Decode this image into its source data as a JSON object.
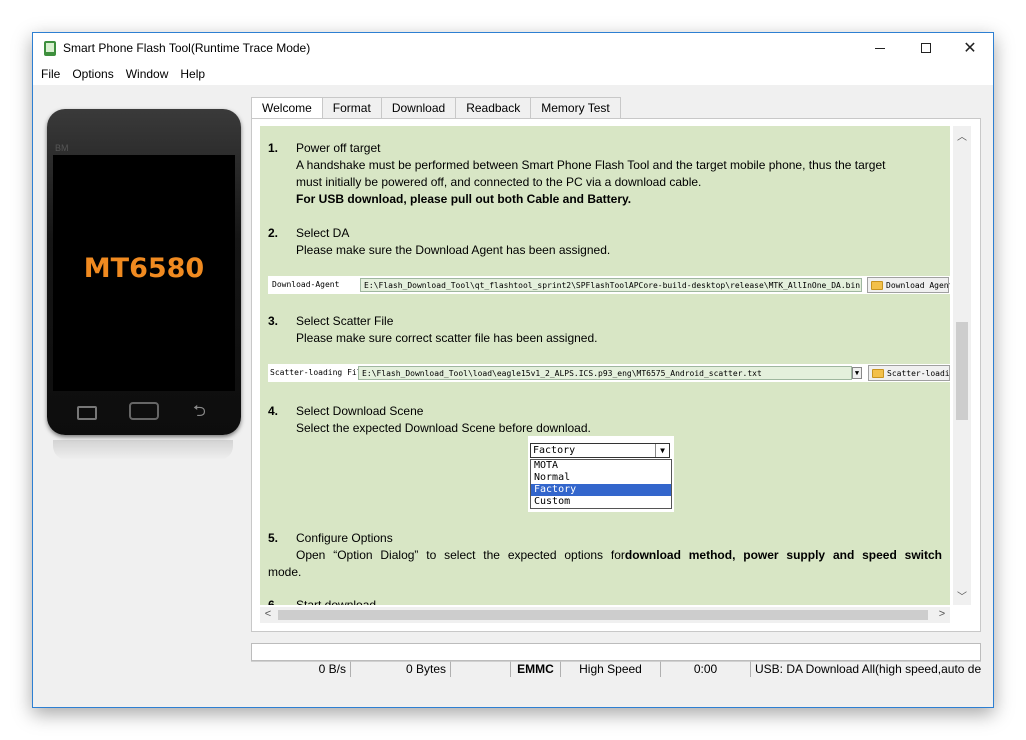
{
  "window": {
    "title": "Smart Phone Flash Tool(Runtime Trace Mode)",
    "min_icon": "minimize-icon",
    "max_icon": "maximize-icon",
    "close_icon": "close-icon"
  },
  "menu": [
    "File",
    "Options",
    "Window",
    "Help"
  ],
  "phone": {
    "brand": "BM",
    "model": "MT6580",
    "model_color": "#f08a20"
  },
  "tabs": [
    "Welcome",
    "Format",
    "Download",
    "Readback",
    "Memory Test"
  ],
  "active_tab": "Welcome",
  "steps": {
    "s1": {
      "num": "1.",
      "title": "Power off target",
      "line1": "A handshake must be performed between Smart Phone Flash Tool and the target mobile phone, thus the target",
      "line2": "must initially be powered off, and connected to the PC via a download cable.",
      "line3": "For USB download, please pull out both Cable and Battery."
    },
    "s2": {
      "num": "2.",
      "title": "Select DA",
      "line1": "Please make sure the Download Agent has been assigned."
    },
    "download_agent": {
      "label": "Download-Agent",
      "path": "E:\\Flash_Download_Tool\\qt_flashtool_sprint2\\SPFlashToolAPCore-build-desktop\\release\\MTK_AllInOne_DA.bin",
      "button": "Download Agent"
    },
    "s3": {
      "num": "3.",
      "title": "Select Scatter File",
      "line1": "Please make sure correct scatter file has been assigned."
    },
    "scatter": {
      "label": "Scatter-loading File",
      "path": "E:\\Flash_Download_Tool\\load\\eagle15v1_2_ALPS.ICS.p93_eng\\MT6575_Android_scatter.txt",
      "button": "Scatter-loading"
    },
    "s4": {
      "num": "4.",
      "title": "Select Download Scene",
      "line1": "Select the expected Download Scene before download."
    },
    "scene": {
      "selected": "Factory",
      "options": [
        "MOTA",
        "Normal",
        "Factory",
        "Custom"
      ]
    },
    "s5": {
      "num": "5.",
      "title": "Configure Options",
      "line1_a": "Open “Option Dialog” to select the expected options for",
      "line1_b": "download method, power supply and speed switch",
      "line2": "mode."
    },
    "s6": {
      "num": "6.",
      "title": "Start download"
    }
  },
  "status": {
    "speed": "0 B/s",
    "bytes": "0 Bytes",
    "blank": "",
    "storage": "EMMC",
    "mode": "High Speed",
    "time": "0:00",
    "usb": "USB: DA Download All(high speed,auto detect)"
  },
  "colors": {
    "content_bg": "#d8e6c5",
    "selected_option": "#3366cc",
    "title_accent": "#2d7fd2"
  }
}
